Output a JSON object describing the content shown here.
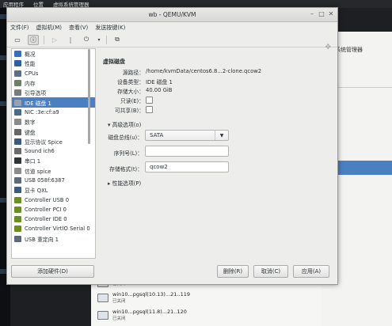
{
  "desktop": {
    "topbar": {
      "apps": "应用程序",
      "places": "位置",
      "app": "虚拟系统管理器"
    },
    "bg_window_title": "系统管理器",
    "vm_list": [
      {
        "name": "",
        "status": "已关闭"
      },
      {
        "name": "win10...pgsql(10.13)...21..119",
        "status": "已关闭"
      },
      {
        "name": "win10...pgsql(11.8)...21..120",
        "status": "已关闭"
      }
    ]
  },
  "window": {
    "title": "wb - QEMU/KVM",
    "menu": [
      "文件(F)",
      "虚拟机(M)",
      "查看(V)",
      "发送按键(K)"
    ]
  },
  "sidebar": {
    "items": [
      {
        "label": "概况",
        "icon": "overview-icon",
        "color": "#3d6db5"
      },
      {
        "label": "性能",
        "icon": "performance-icon",
        "color": "#2f5f9e"
      },
      {
        "label": "CPUs",
        "icon": "cpu-icon",
        "color": "#5a6f86"
      },
      {
        "label": "内存",
        "icon": "memory-icon",
        "color": "#6f7f6a"
      },
      {
        "label": "引导选项",
        "icon": "gear-icon",
        "color": "#7a7a7a"
      },
      {
        "label": "IDE 磁盘 1",
        "icon": "disk-icon",
        "color": "#9aa3ad",
        "selected": true
      },
      {
        "label": "NIC :3e:cf:a9",
        "icon": "nic-icon",
        "color": "#4a6a8a"
      },
      {
        "label": "数字",
        "icon": "tablet-icon",
        "color": "#8a8a8a"
      },
      {
        "label": "键盘",
        "icon": "keyboard-icon",
        "color": "#666"
      },
      {
        "label": "显示协议 Spice",
        "icon": "display-icon",
        "color": "#3c5a7a"
      },
      {
        "label": "Sound ich6",
        "icon": "sound-icon",
        "color": "#6a6a6a"
      },
      {
        "label": "串口 1",
        "icon": "serial-icon",
        "color": "#2e3436"
      },
      {
        "label": "信道 spice",
        "icon": "channel-icon",
        "color": "#8c8c8c"
      },
      {
        "label": "USB 058f:6387",
        "icon": "usb-icon",
        "color": "#5b6b7b"
      },
      {
        "label": "显卡 QXL",
        "icon": "video-icon",
        "color": "#3c5a7a"
      },
      {
        "label": "Controller USB 0",
        "icon": "controller-icon",
        "color": "#6b8e23"
      },
      {
        "label": "Controller PCI 0",
        "icon": "controller-icon",
        "color": "#6b8e23"
      },
      {
        "label": "Controller IDE 0",
        "icon": "controller-icon",
        "color": "#6b8e23"
      },
      {
        "label": "Controller VirtIO Serial 0",
        "icon": "controller-icon",
        "color": "#6b8e23"
      },
      {
        "label": "USB 重定向 1",
        "icon": "usb-redir-icon",
        "color": "#5b6b7b"
      }
    ],
    "add_hardware": "添加硬件(D)"
  },
  "detail": {
    "section": "虚拟磁盘",
    "source_path_label": "源路径：",
    "source_path": "/home/kvmData/centos6.8...2-clone.qcow2",
    "device_type_label": "设备类型：",
    "device_type": "IDE 磁盘 1",
    "storage_size_label": "存储大小：",
    "storage_size": "40.00 GiB",
    "readonly_label": "只读(E)：",
    "shareable_label": "可共享(B)：",
    "advanced_label": "▾ 高级选项(o)",
    "disk_bus_label": "磁盘总线(u)：",
    "disk_bus": "SATA",
    "serial_label": "序列号(L)：",
    "serial": "",
    "storage_format_label": "存储格式(t)：",
    "storage_format": "qcow2",
    "performance_label": "▸ 性能选项(P)"
  },
  "buttons": {
    "remove": "删除(R)",
    "cancel": "取消(C)",
    "apply": "应用(A)"
  }
}
